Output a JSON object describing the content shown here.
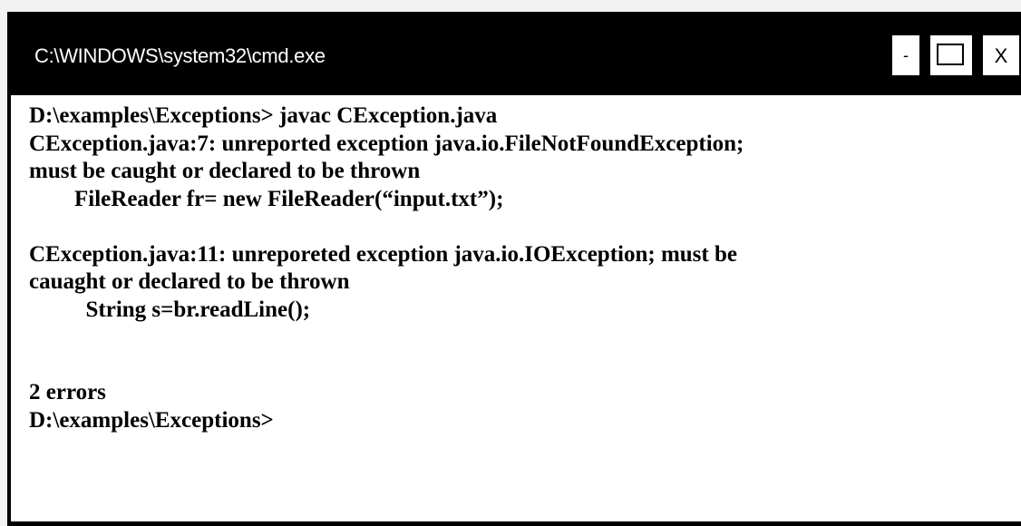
{
  "window": {
    "title": "C:\\WINDOWS\\system32\\cmd.exe",
    "buttons": {
      "minimize": "-",
      "maximize": "",
      "close": "X"
    }
  },
  "console": {
    "lines": [
      "D:\\examples\\Exceptions> javac CException.java",
      "CException.java:7: unreported exception java.io.FileNotFoundException;",
      "must be caught or declared to be thrown",
      "        FileReader fr= new FileReader(“input.txt”);",
      "",
      "CException.java:11: unreporeted exception java.io.IOException; must be",
      "cauaght or declared to be thrown",
      "          String s=br.readLine();",
      "",
      "",
      "2 errors",
      "D:\\examples\\Exceptions>"
    ]
  },
  "colors": {
    "window_frame": "#000000",
    "title_text": "#ffffff",
    "console_background": "#ffffff",
    "console_text": "#000000"
  }
}
